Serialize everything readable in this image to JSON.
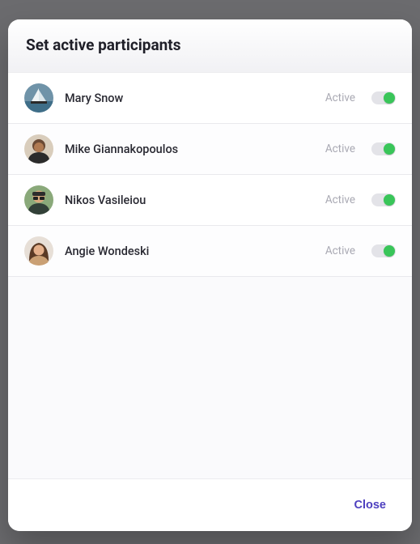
{
  "modal": {
    "title": "Set active participants",
    "close_label": "Close"
  },
  "participants": [
    {
      "name": "Mary Snow",
      "status": "Active",
      "active": true,
      "avatar_kind": "ship"
    },
    {
      "name": "Mike Giannakopoulos",
      "status": "Active",
      "active": true,
      "avatar_kind": "mike"
    },
    {
      "name": "Nikos Vasileiou",
      "status": "Active",
      "active": true,
      "avatar_kind": "nikos"
    },
    {
      "name": "Angie Wondeski",
      "status": "Active",
      "active": true,
      "avatar_kind": "angie"
    }
  ],
  "colors": {
    "toggle_on": "#39c559",
    "link": "#4d3fbf"
  }
}
